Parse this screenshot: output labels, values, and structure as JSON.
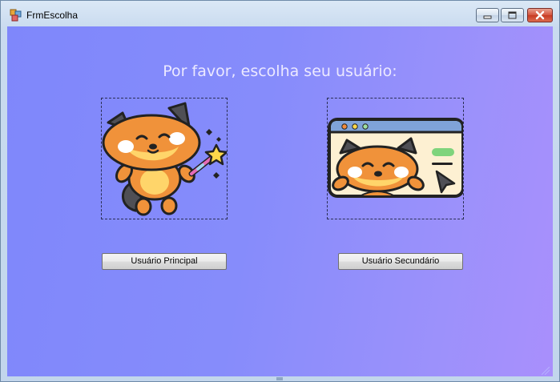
{
  "window": {
    "title": "FrmEscolha",
    "icon": "form-icon",
    "controls": [
      "minimize-icon",
      "maximize-icon",
      "close-icon"
    ]
  },
  "main": {
    "heading": "Por favor, escolha seu usuário:",
    "users": [
      {
        "image": "fox-with-magic-wand",
        "button_label": "Usuário Principal"
      },
      {
        "image": "fox-in-browser-window",
        "button_label": "Usuário Secundário"
      }
    ]
  },
  "colors": {
    "background_start": "#7f87fb",
    "background_end": "#a98ffc",
    "heading_text": "#ece9ff",
    "close_button": "#c63a22"
  }
}
